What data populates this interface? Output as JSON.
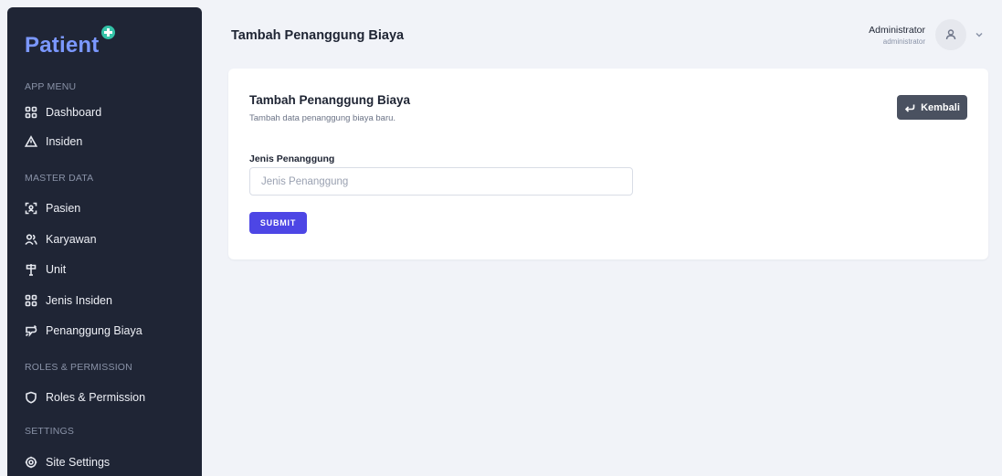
{
  "brand": {
    "name": "Patient"
  },
  "sidebar": {
    "sections": [
      {
        "label": "APP MENU"
      },
      {
        "label": "MASTER DATA"
      },
      {
        "label": "ROLES & PERMISSION"
      },
      {
        "label": "SETTINGS"
      }
    ],
    "items": [
      {
        "label": "Dashboard",
        "icon": "dashboard-icon"
      },
      {
        "label": "Insiden",
        "icon": "warning-icon"
      },
      {
        "label": "Pasien",
        "icon": "scan-user-icon"
      },
      {
        "label": "Karyawan",
        "icon": "users-icon"
      },
      {
        "label": "Unit",
        "icon": "signpost-icon"
      },
      {
        "label": "Jenis Insiden",
        "icon": "grid-icon"
      },
      {
        "label": "Penanggung Biaya",
        "icon": "plug-icon"
      },
      {
        "label": "Roles & Permission",
        "icon": "shield-icon"
      },
      {
        "label": "Site Settings",
        "icon": "gear-icon"
      }
    ]
  },
  "header": {
    "title": "Tambah Penanggung Biaya",
    "user": {
      "name": "Administrator",
      "role": "administrator"
    }
  },
  "card": {
    "title": "Tambah Penanggung Biaya",
    "subtitle": "Tambah data penanggung biaya baru.",
    "back_label": "Kembali",
    "field": {
      "label": "Jenis Penanggung",
      "value": "",
      "placeholder": "Jenis Penanggung"
    },
    "submit_label": "SUBMIT"
  },
  "colors": {
    "sidebar_bg": "#1f2535",
    "brand": "#7b98ff",
    "brand_badge": "#34c3a8",
    "primary_button": "#4d46e5",
    "back_button": "#4a5160",
    "page_bg": "#f1f3f8"
  }
}
